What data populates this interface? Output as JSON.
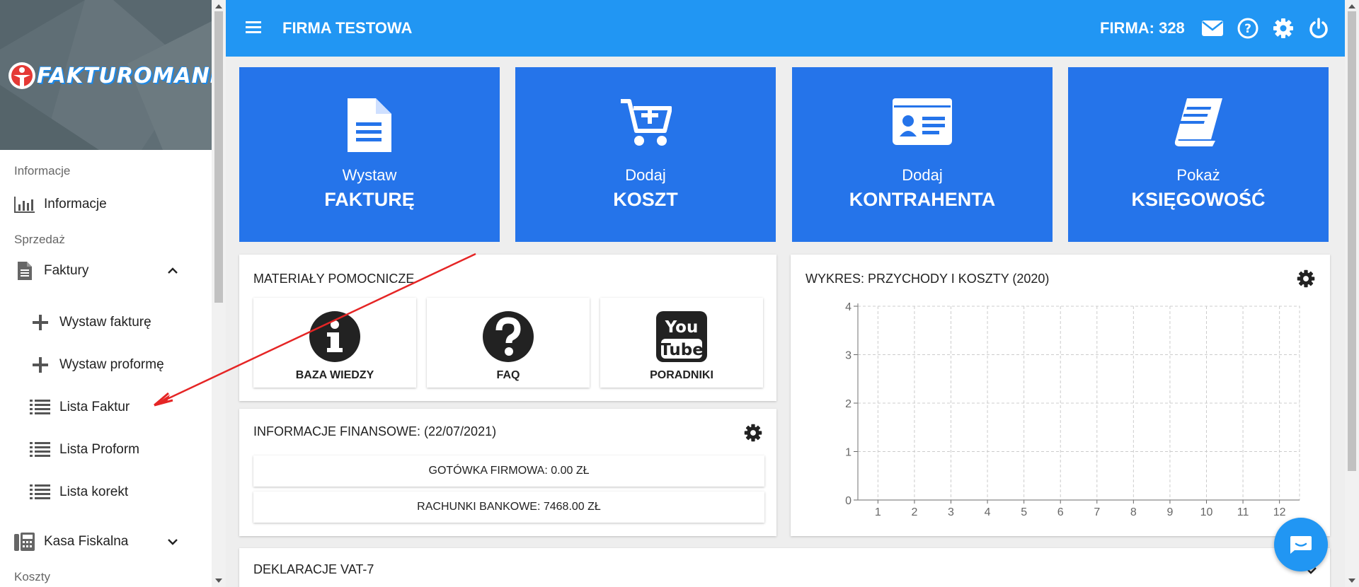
{
  "logo": {
    "text": "FAKTUROMANIA"
  },
  "sidebar": {
    "sections": {
      "informacje": "Informacje",
      "sprzedaz": "Sprzedaż",
      "koszty": "Koszty"
    },
    "items": {
      "informacje": "Informacje",
      "faktury": "Faktury",
      "wystaw_fakture": "Wystaw fakturę",
      "wystaw_proforme": "Wystaw proformę",
      "lista_faktur": "Lista Faktur",
      "lista_proform": "Lista Proform",
      "lista_korekt": "Lista korekt",
      "kasa_fiskalna": "Kasa Fiskalna"
    }
  },
  "header": {
    "company_name": "FIRMA TESTOWA",
    "firma_label": "FIRMA: 328",
    "bg_color": "#2196f3"
  },
  "tiles": [
    {
      "line1": "Wystaw",
      "line2": "FAKTURĘ",
      "icon": "document-icon"
    },
    {
      "line1": "Dodaj",
      "line2": "KOSZT",
      "icon": "cart-plus-icon"
    },
    {
      "line1": "Dodaj",
      "line2": "KONTRAHENTA",
      "icon": "id-card-icon"
    },
    {
      "line1": "Pokaż",
      "line2": "KSIĘGOWOŚĆ",
      "icon": "book-icon"
    }
  ],
  "materials": {
    "title": "MATERIAŁY POMOCNICZE",
    "items": [
      {
        "label": "BAZA WIEDZY",
        "icon": "info-icon"
      },
      {
        "label": "FAQ",
        "icon": "question-icon"
      },
      {
        "label": "PORADNIKI",
        "icon": "youtube-icon",
        "icon_text_top": "You",
        "icon_text_bottom": "Tube"
      }
    ]
  },
  "finance": {
    "title": "INFORMACJE FINANSOWE: (22/07/2021)",
    "cash": "GOTÓWKA FIRMOWA: 0.00 ZŁ",
    "bank": "RACHUNKI BANKOWE: 7468.00 ZŁ"
  },
  "vat": {
    "title": "DEKLARACJE VAT-7"
  },
  "chart": {
    "title": "WYKRES: PRZYCHODY I KOSZTY (2020)"
  },
  "chart_data": {
    "type": "line",
    "title": "WYKRES: PRZYCHODY I KOSZTY (2020)",
    "x": [
      1,
      2,
      3,
      4,
      5,
      6,
      7,
      8,
      9,
      10,
      11,
      12
    ],
    "y_ticks": [
      0,
      1,
      2,
      3,
      4
    ],
    "ylim": [
      0,
      4
    ],
    "grid": true,
    "series": []
  }
}
